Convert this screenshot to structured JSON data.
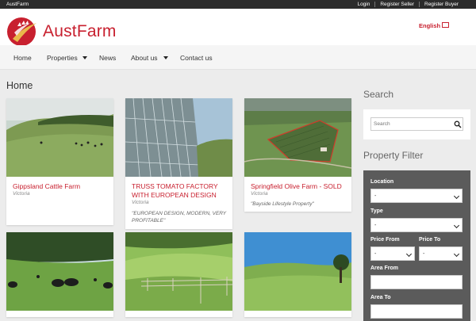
{
  "topbar": {
    "brand": "AustFarm",
    "links": [
      "Login",
      "Register Seller",
      "Register Buyer"
    ]
  },
  "header": {
    "logo_text": "AustFarm",
    "language": "English"
  },
  "nav": {
    "items": [
      {
        "label": "Home"
      },
      {
        "label": "Properties"
      },
      {
        "label": "News"
      },
      {
        "label": "About us"
      },
      {
        "label": "Contact us"
      }
    ]
  },
  "page_title": "Home",
  "listings": [
    {
      "title": "Gippsland Cattle Farm",
      "location": "Victoria",
      "description": ""
    },
    {
      "title": "TRUSS TOMATO FACTORY WITH EUROPEAN DESIGN",
      "location": "Victoria",
      "description": "\"EUROPEAN DESIGN, MODERN, VERY PROFITABLE\""
    },
    {
      "title": "Springfield Olive Farm - SOLD",
      "location": "Victoria",
      "description": "\"Bayside Lifestyle Property\""
    },
    {
      "title": "",
      "location": "",
      "description": ""
    },
    {
      "title": "",
      "location": "",
      "description": ""
    },
    {
      "title": "",
      "location": "",
      "description": ""
    }
  ],
  "sidebar": {
    "search_heading": "Search",
    "search_placeholder": "Search",
    "filter_heading": "Property Filter",
    "filters": {
      "location_label": "Location",
      "location_value": "-",
      "type_label": "Type",
      "type_value": "-",
      "price_from_label": "Price From",
      "price_from_value": "-",
      "price_to_label": "Price To",
      "price_to_value": "-",
      "area_from_label": "Area From",
      "area_to_label": "Area To"
    }
  },
  "colors": {
    "brand_red": "#c8202f",
    "topbar": "#2b2b2b",
    "filter_bg": "#5b5b5b"
  }
}
